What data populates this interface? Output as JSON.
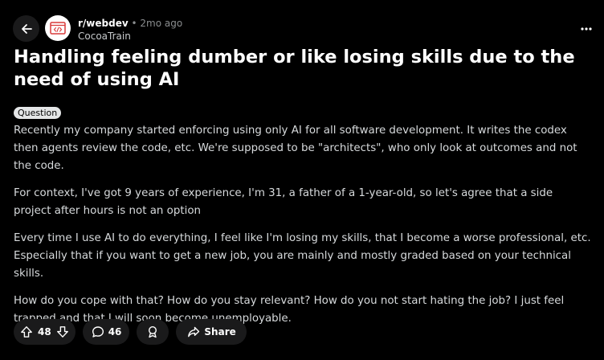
{
  "post": {
    "subreddit": "r/webdev",
    "separator": "•",
    "time": "2mo ago",
    "author": "CocoaTrain",
    "title": "Handling feeling dumber or like losing skills due to the need of using AI",
    "flair": "Question",
    "body": [
      "Recently my company started enforcing using only AI for all software development. It writes the codex then agents review the code, etc. We're supposed to be \"architects\", who only look at outcomes and not the code.",
      "For context, I've got 9 years of experience, I'm 31, a father of a 1-year-old, so let's agree that a side project after hours is not an option",
      "Every time I use AI to do everything, I feel like I'm losing my skills, that I become a worse professional, etc. Especially that if you want to get a new job, you are mainly and mostly graded based on your technical skills.",
      "How do you cope with that? How do you stay relevant? How do you not start hating the job? I just feel trapped and that I will soon become unemployable."
    ]
  },
  "actions": {
    "votes": "48",
    "comments": "46",
    "share_label": "Share"
  },
  "icons": {
    "back": "arrow-left-icon",
    "avatar": "code-window-icon",
    "more": "ellipsis-icon",
    "upvote": "arrow-up-icon",
    "downvote": "arrow-down-icon",
    "comment": "speech-bubble-icon",
    "award": "award-ribbon-icon",
    "share": "share-arrow-icon"
  },
  "colors": {
    "background": "#000000",
    "pill": "#1a1a1b",
    "avatar_accent": "#d93a3a",
    "muted_text": "#8a8d8f",
    "body_text": "#d7dadc"
  }
}
